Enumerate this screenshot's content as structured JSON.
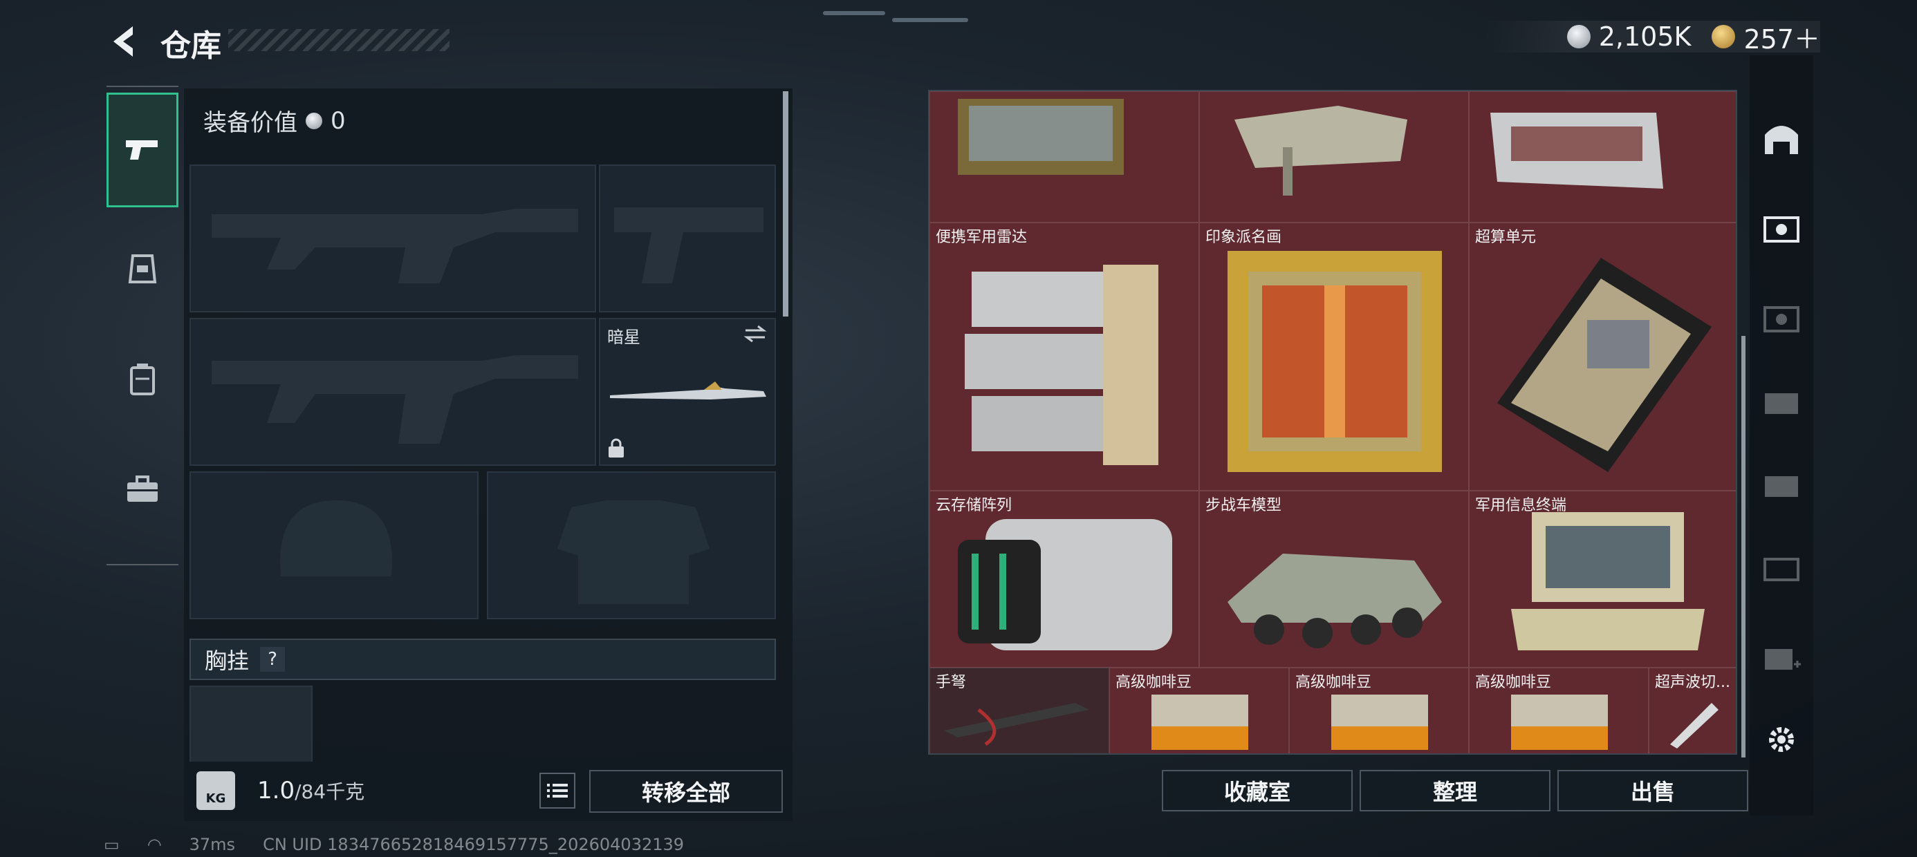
{
  "header": {
    "title": "仓库"
  },
  "currencies": [
    {
      "icon": "silver-coin-icon",
      "value": "2,105K"
    },
    {
      "icon": "gold-coin-icon",
      "value": "257＋"
    }
  ],
  "rail": [
    {
      "name": "weapons",
      "icon": "pistol-icon",
      "active": true
    },
    {
      "name": "gear",
      "icon": "helmet-icon",
      "active": false
    },
    {
      "name": "backpack",
      "icon": "backpack-icon",
      "active": false
    },
    {
      "name": "case",
      "icon": "briefcase-icon",
      "active": false
    }
  ],
  "equipment": {
    "value_label": "装备价值",
    "value": "0",
    "melee_label": "暗星",
    "chest_label": "胸挂",
    "chest_help": "?"
  },
  "capacity": {
    "value": "1.0",
    "max": "/84千克",
    "icon_text": "KG"
  },
  "buttons": {
    "transfer_all": "转移全部",
    "collection": "收藏室",
    "organize": "整理",
    "sell": "出售"
  },
  "items": [
    {
      "label": "便携军用雷达"
    },
    {
      "label": "印象派名画"
    },
    {
      "label": "超算单元"
    },
    {
      "label": "云存储阵列"
    },
    {
      "label": "步战车模型"
    },
    {
      "label": "军用信息终端"
    },
    {
      "label": "手弩"
    },
    {
      "label": "高级咖啡豆"
    },
    {
      "label": "高级咖啡豆"
    },
    {
      "label": "高级咖啡豆"
    },
    {
      "label": "超声波切..."
    }
  ],
  "status": {
    "ping": "37ms",
    "uid": "CN UID 183476652818469157775_202604032139"
  },
  "colors": {
    "accent": "#2fc08e",
    "grid_bg": "#5a2a30"
  }
}
